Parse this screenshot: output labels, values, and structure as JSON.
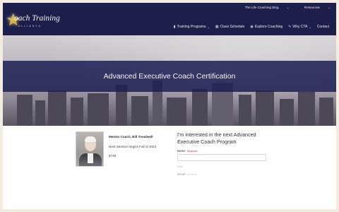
{
  "header": {
    "logo": {
      "name": "oach Training",
      "sub": "ALLIANCE"
    },
    "top_links": [
      {
        "label": "The Life Coaching Blog",
        "caret": "⌄"
      },
      {
        "label": "Resources",
        "caret": "⌄"
      }
    ],
    "nav": [
      {
        "label": "Training Programs",
        "icon": "book-icon",
        "caret": "⌄"
      },
      {
        "label": "Class Schedule",
        "icon": "calendar-icon"
      },
      {
        "label": "Explore Coaching",
        "icon": "pin-icon"
      },
      {
        "label": "Why CTA",
        "icon": "wrench-icon",
        "caret": "⌄"
      },
      {
        "label": "Contact"
      }
    ]
  },
  "hero": {
    "title": "Advanced Executive Coach Certification"
  },
  "program": {
    "coach": "Mentor Coach, Bill Treadwell",
    "session": "Next Session begins Fall of 2024",
    "price": "$749"
  },
  "form": {
    "title": "I'm interested in the next Advanced Executive Coach Program",
    "name_label": "Name",
    "required": "Required",
    "first_label": "First",
    "email_label": "Email",
    "email_hint": "Required"
  },
  "colors": {
    "header_bg": "#1d1f4a",
    "band_bg": "#1e2054",
    "accent_gold": "#d9b44a",
    "page_bg": "#f4ece0"
  }
}
